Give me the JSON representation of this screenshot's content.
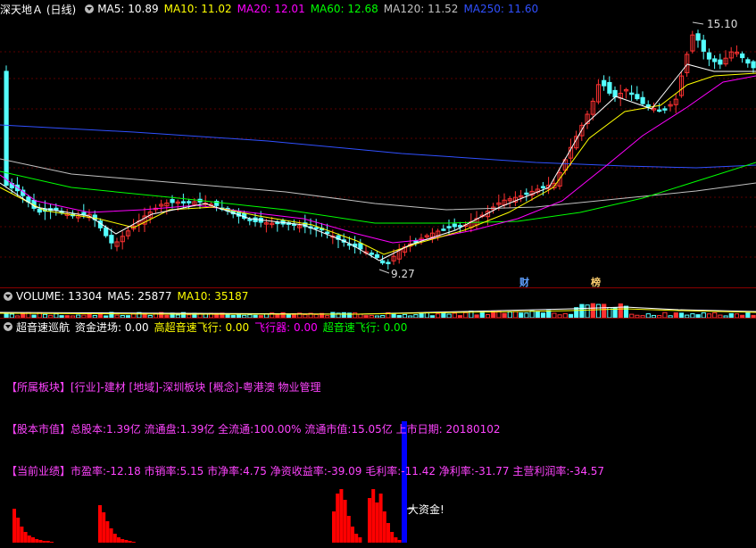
{
  "main": {
    "title": "深天地Ａ (日线)",
    "ma": [
      {
        "label": "MA5: 10.89",
        "color": "#ffffff"
      },
      {
        "label": "MA10: 11.02",
        "color": "#ffff00"
      },
      {
        "label": "MA20: 12.01",
        "color": "#ff00ff"
      },
      {
        "label": "MA60: 12.68",
        "color": "#00ff00"
      },
      {
        "label": "MA120: 11.52",
        "color": "#c0c0c0"
      },
      {
        "label": "MA250: 11.60",
        "color": "#3050ff"
      }
    ],
    "high_label": "15.10",
    "low_label": "9.27",
    "marker_cai": "财",
    "marker_bang": "榜"
  },
  "volume": {
    "labels": [
      {
        "label": "VOLUME: 13304",
        "color": "#ffffff"
      },
      {
        "label": "MA5: 25877",
        "color": "#ffffff"
      },
      {
        "label": "MA10: 35187",
        "color": "#ffff00"
      }
    ]
  },
  "indicator": {
    "labels": [
      {
        "label": "超音速巡航",
        "color": "#ffffff"
      },
      {
        "label": "资金进场: 0.00",
        "color": "#ffffff"
      },
      {
        "label": "高超音速飞行: 0.00",
        "color": "#ffff00"
      },
      {
        "label": "飞行器: 0.00",
        "color": "#ff00ff"
      },
      {
        "label": "超音速飞行: 0.00",
        "color": "#00ff00"
      }
    ],
    "sector": "【所属板块】[行业]-建材 [地域]-深圳板块 [概念]-粤港澳 物业管理",
    "capital": "【股本市值】总股本:1.39亿 流通盘:1.39亿 全流通:100.00% 流通市值:15.05亿 上市日期: 20180102",
    "performance": "【当前业绩】市盈率:-12.18 市销率:5.15 市净率:4.75 净资收益率:-39.09 毛利率:-11.42 净利率:-31.77 主营利润率:-34.57",
    "big_money": "大资金!"
  },
  "colors": {
    "up": "#ff3232",
    "down": "#54ffff",
    "info_text": "#ff44ff",
    "bar": "#ff0000",
    "blue_bar": "#0000ff"
  }
}
